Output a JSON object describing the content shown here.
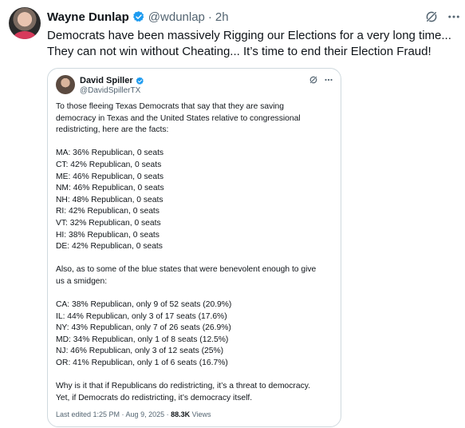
{
  "post": {
    "author_name": "Wayne Dunlap",
    "author_handle": "@wdunlap",
    "separator": "·",
    "time": "2h",
    "text_lines": [
      "Democrats have been massively Rigging our Elections for a very long time...",
      "They can not win without Cheating... It’s time to end their Election Fraud!"
    ]
  },
  "quote": {
    "author_name": "David Spiller",
    "author_handle": "@DavidSpillerTX",
    "intro_lines": [
      "To those fleeing Texas Democrats that say that they are saving",
      "democracy in Texas and the United States relative to congressional",
      "redistricting, here are the facts:"
    ],
    "list1": [
      "MA: 36% Republican, 0 seats",
      "CT: 42% Republican, 0 seats",
      "ME: 46% Republican, 0 seats",
      "NM: 46% Republican, 0 seats",
      "NH: 48% Republican, 0 seats",
      "RI: 42% Republican, 0 seats",
      "VT: 32% Republican, 0 seats",
      "HI: 38% Republican, 0 seats",
      "DE: 42% Republican, 0 seats"
    ],
    "middle_lines": [
      "Also, as to some of the blue states that were benevolent enough to give",
      "us a smidgen:"
    ],
    "list2": [
      "CA: 38% Republican, only 9 of 52 seats (20.9%)",
      "IL: 44% Republican, only 3 of 17 seats (17.6%)",
      "NY: 43% Republican, only 7 of 26 seats (26.9%)",
      "MD: 34% Republican, only 1 of 8 seats (12.5%)",
      "NJ: 46% Republican, only 3 of 12 seats (25%)",
      "OR: 41% Republican, only 1 of 6 seats (16.7%)"
    ],
    "closing_lines": [
      "Why is it that if Republicans do redistricting, it’s a threat to democracy.",
      "Yet, if Democrats do redistricting, it’s democracy itself."
    ],
    "footer": {
      "edited": "Last edited 1:25 PM · Aug 9, 2025 ·",
      "views_count": "88.3K",
      "views_label": "Views"
    }
  },
  "icons": {
    "verified": "verified-badge-icon",
    "grok": "grok-icon",
    "more": "more-options-icon"
  },
  "colors": {
    "verified": "#1d9bf0",
    "text": "#0f1419",
    "secondary": "#536471",
    "border": "#cfd9de"
  }
}
